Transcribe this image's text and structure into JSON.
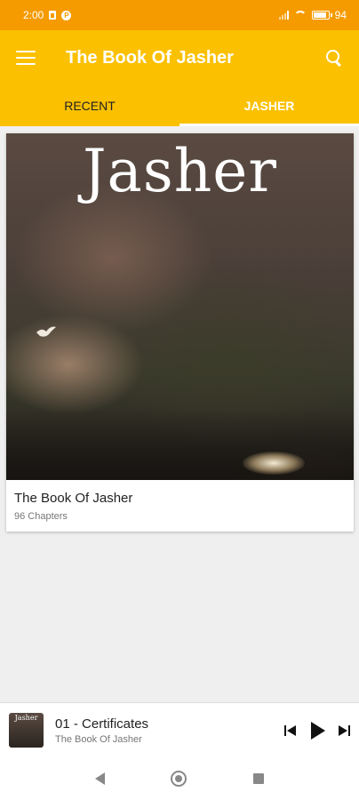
{
  "status_bar": {
    "time": "2:00",
    "battery": "94"
  },
  "app_bar": {
    "title": "The Book Of Jasher"
  },
  "tabs": [
    {
      "label": "RECENT",
      "active": false
    },
    {
      "label": "JASHER",
      "active": true
    }
  ],
  "book": {
    "cover_title": "Jasher",
    "title": "The Book Of Jasher",
    "subtitle": "96 Chapters"
  },
  "player": {
    "thumb_title": "Jasher",
    "track_title": "01 - Certificates",
    "track_subtitle": "The Book Of Jasher"
  },
  "colors": {
    "status_bar": "#f59b00",
    "app_bar": "#fbc000",
    "background": "#efefef"
  }
}
